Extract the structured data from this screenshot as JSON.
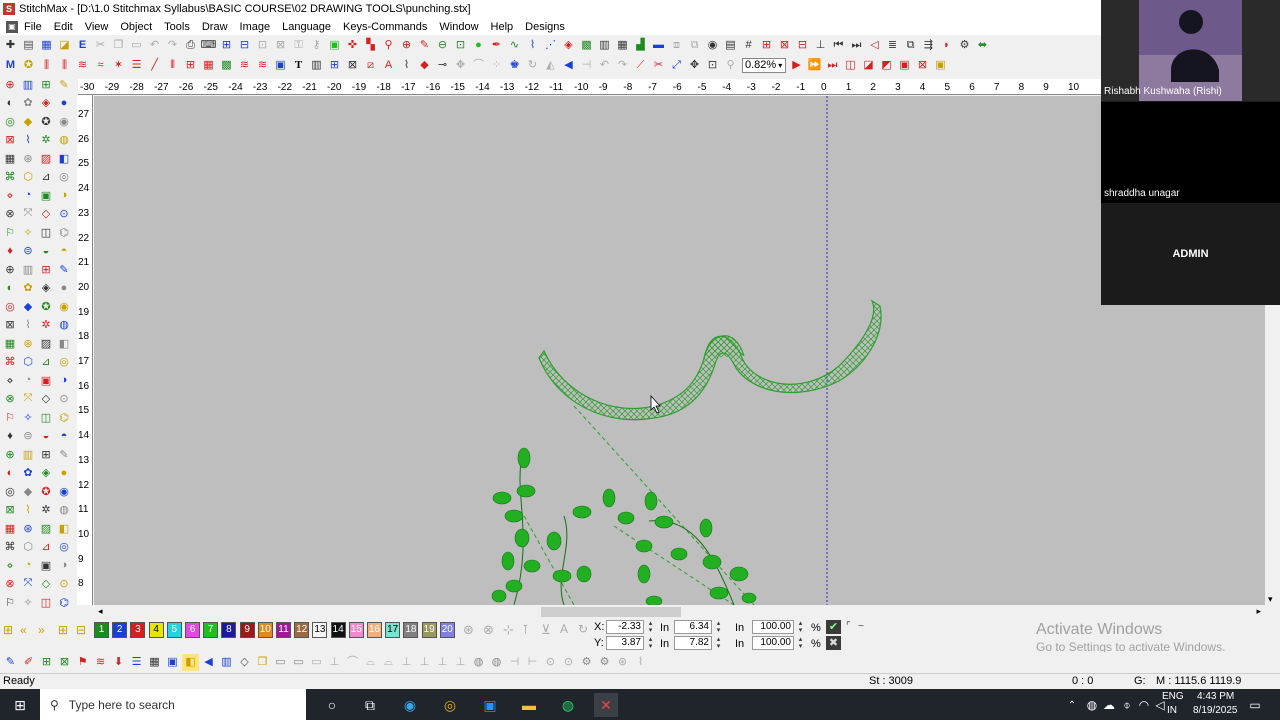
{
  "window": {
    "title": "StitchMax - [D:\\1.0 Stitchmax Syllabus\\BASIC COURSE\\02 DRAWING TOOLS\\punching.stx]"
  },
  "menu": [
    "File",
    "Edit",
    "View",
    "Object",
    "Tools",
    "Draw",
    "Image",
    "Language",
    "Keys-Commands",
    "Window",
    "Help",
    "Designs"
  ],
  "toolbar": {
    "zoom_value": "0.82%"
  },
  "ruler": {
    "h_ticks": [
      "-30",
      "-29",
      "-28",
      "-27",
      "-26",
      "-25",
      "-24",
      "-23",
      "-22",
      "-21",
      "-20",
      "-19",
      "-18",
      "-17",
      "-16",
      "-15",
      "-14",
      "-13",
      "-12",
      "-11",
      "-10",
      "-9",
      "-8",
      "-7",
      "-6",
      "-5",
      "-4",
      "-3",
      "-2",
      "-1",
      "0",
      "1",
      "2",
      "3",
      "4",
      "5",
      "6",
      "7",
      "8",
      "9",
      "10"
    ],
    "v_ticks": [
      "27",
      "26",
      "25",
      "24",
      "23",
      "22",
      "21",
      "20",
      "19",
      "18",
      "17",
      "16",
      "15",
      "14",
      "13",
      "12",
      "11",
      "10",
      "9",
      "8"
    ]
  },
  "colorbar": {
    "swatches": [
      {
        "label": "1",
        "color": "#1f8a1f"
      },
      {
        "label": "2",
        "color": "#1a3fd6"
      },
      {
        "label": "3",
        "color": "#d62020"
      },
      {
        "label": "4",
        "color": "#e6e600"
      },
      {
        "label": "5",
        "color": "#22d4e0"
      },
      {
        "label": "6",
        "color": "#e04ae0"
      },
      {
        "label": "7",
        "color": "#1fbf1f"
      },
      {
        "label": "8",
        "color": "#1a1a9a"
      },
      {
        "label": "9",
        "color": "#9a1a1a"
      },
      {
        "label": "10",
        "color": "#e08a20"
      },
      {
        "label": "11",
        "color": "#9a1a9a"
      },
      {
        "label": "12",
        "color": "#9a6a40"
      },
      {
        "label": "13",
        "color": "#f4f4f4"
      },
      {
        "label": "14",
        "color": "#101010"
      },
      {
        "label": "15",
        "color": "#f08ad0"
      },
      {
        "label": "16",
        "color": "#f0b080"
      },
      {
        "label": "17",
        "color": "#80e0d0"
      },
      {
        "label": "18",
        "color": "#808080"
      },
      {
        "label": "19",
        "color": "#9a9a60"
      },
      {
        "label": "20",
        "color": "#8080e0"
      }
    ],
    "x_label": "X:",
    "y_label": "Y:",
    "x_value": "-2.33",
    "y_value": "3.87",
    "w_value": "6.34",
    "h_value": "7.82",
    "unit1": "In",
    "unit2": "In",
    "unit3": "In",
    "unit4": "In",
    "scale_x": "100.00",
    "scale_y": "100.00",
    "pct1": "%",
    "pct2": "%"
  },
  "watermark": {
    "line1": "Activate Windows",
    "line2": "Go to Settings to activate Windows."
  },
  "status": {
    "ready": "Ready",
    "stitches": "St : 3009",
    "origin": "0 : 0",
    "g_label": "G:",
    "mouse": "M : 1115.6  1119.9"
  },
  "taskbar": {
    "search_placeholder": "Type here to search",
    "lang1": "ENG",
    "lang2": "IN",
    "time": "4:43 PM",
    "date": "8/19/2025"
  },
  "participants": [
    {
      "name": "Rishabh Kushwaha (Rishi)"
    },
    {
      "name": "shraddha unagar"
    },
    {
      "name": "ADMIN"
    }
  ]
}
